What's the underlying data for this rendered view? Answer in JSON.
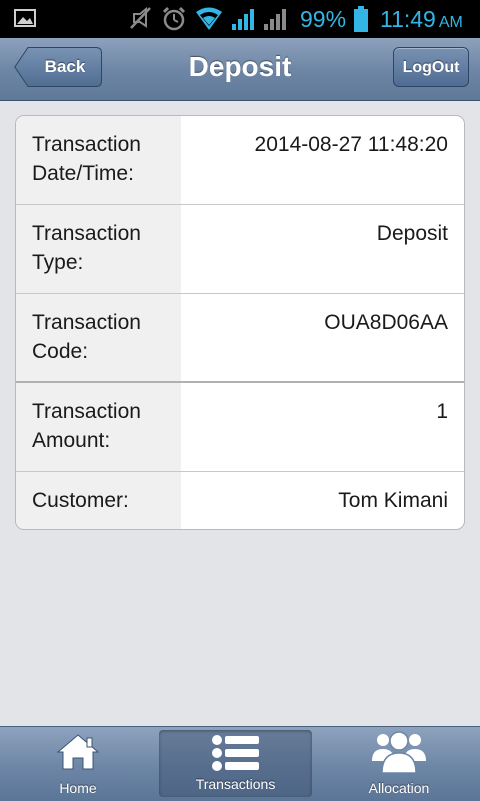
{
  "status_bar": {
    "battery_percent": "99%",
    "time": "11:49",
    "ampm": "AM",
    "icons": [
      "image-icon",
      "mute-icon",
      "alarm-icon",
      "wifi-icon",
      "signal-icon",
      "signal-icon",
      "battery-icon"
    ]
  },
  "header": {
    "title": "Deposit",
    "back_label": "Back",
    "logout_label": "LogOut"
  },
  "details": [
    {
      "label": "Transaction Date/Time:",
      "value": "2014-08-27 11:48:20"
    },
    {
      "label": "Transaction Type:",
      "value": "Deposit"
    },
    {
      "label": "Transaction Code:",
      "value": "OUA8D06AA"
    },
    {
      "label": "Transaction Amount:",
      "value": "1"
    },
    {
      "label": "Customer:",
      "value": "Tom Kimani"
    }
  ],
  "tabs": [
    {
      "label": "Home",
      "icon": "home-icon",
      "active": false
    },
    {
      "label": "Transactions",
      "icon": "list-icon",
      "active": true
    },
    {
      "label": "Allocation",
      "icon": "users-icon",
      "active": false
    }
  ],
  "colors": {
    "status_accent": "#33b5e5",
    "header_blue": "#6f87a6",
    "background": "#e3e4e8"
  }
}
